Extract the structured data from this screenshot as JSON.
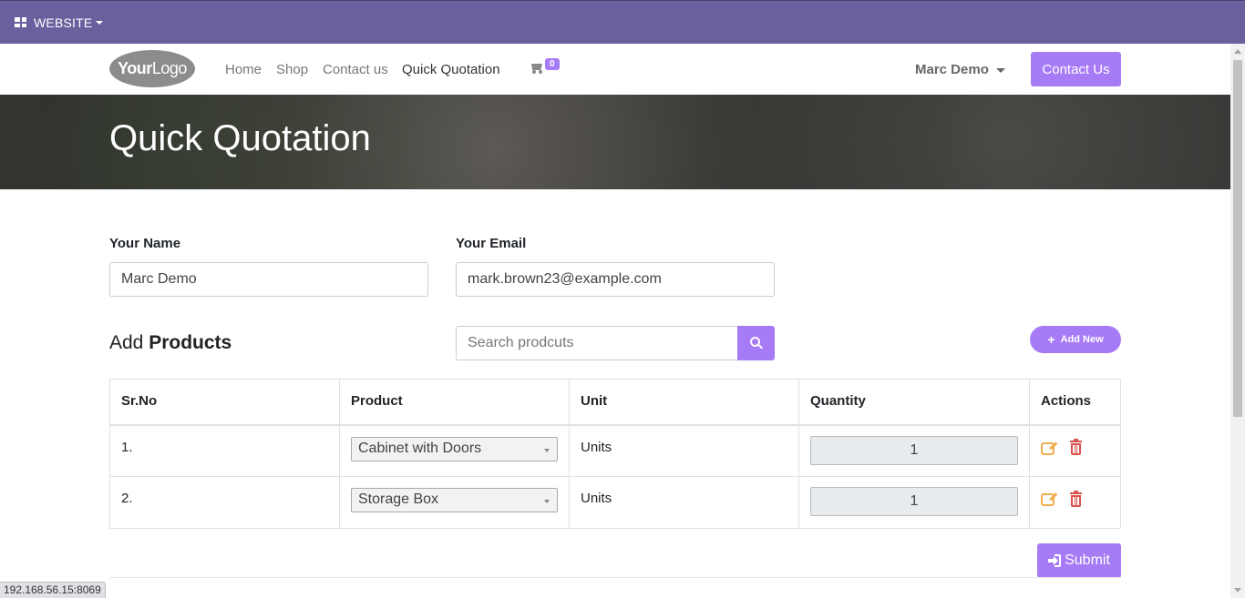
{
  "admin_bar": {
    "menu_label": "WEBSITE"
  },
  "navbar": {
    "logo": {
      "bold": "Your",
      "thin": "Logo"
    },
    "links": [
      "Home",
      "Shop",
      "Contact us",
      "Quick Quotation"
    ],
    "active_link": "Quick Quotation",
    "cart_count": "0",
    "user_name": "Marc Demo",
    "contact_button": "Contact Us"
  },
  "banner": {
    "title": "Quick Quotation"
  },
  "form": {
    "name_label": "Your Name",
    "name_value": "Marc Demo",
    "email_label": "Your Email",
    "email_value": "mark.brown23@example.com"
  },
  "products_section": {
    "title_prefix": "Add",
    "title_bold": "Products",
    "search_placeholder": "Search prodcuts",
    "add_new_label": "Add New",
    "columns": [
      "Sr.No",
      "Product",
      "Unit",
      "Quantity",
      "Actions"
    ],
    "rows": [
      {
        "sr": "1.",
        "product": "Cabinet with Doors",
        "unit": "Units",
        "quantity": "1"
      },
      {
        "sr": "2.",
        "product": "Storage Box",
        "unit": "Units",
        "quantity": "1"
      }
    ],
    "submit_label": "Submit"
  },
  "status_bar": {
    "url": "192.168.56.15:8069"
  },
  "colors": {
    "accent": "#a77af6",
    "admin_bar": "#6c5f9e",
    "edit_icon": "#f0ad4e",
    "delete_icon": "#d9534f"
  }
}
